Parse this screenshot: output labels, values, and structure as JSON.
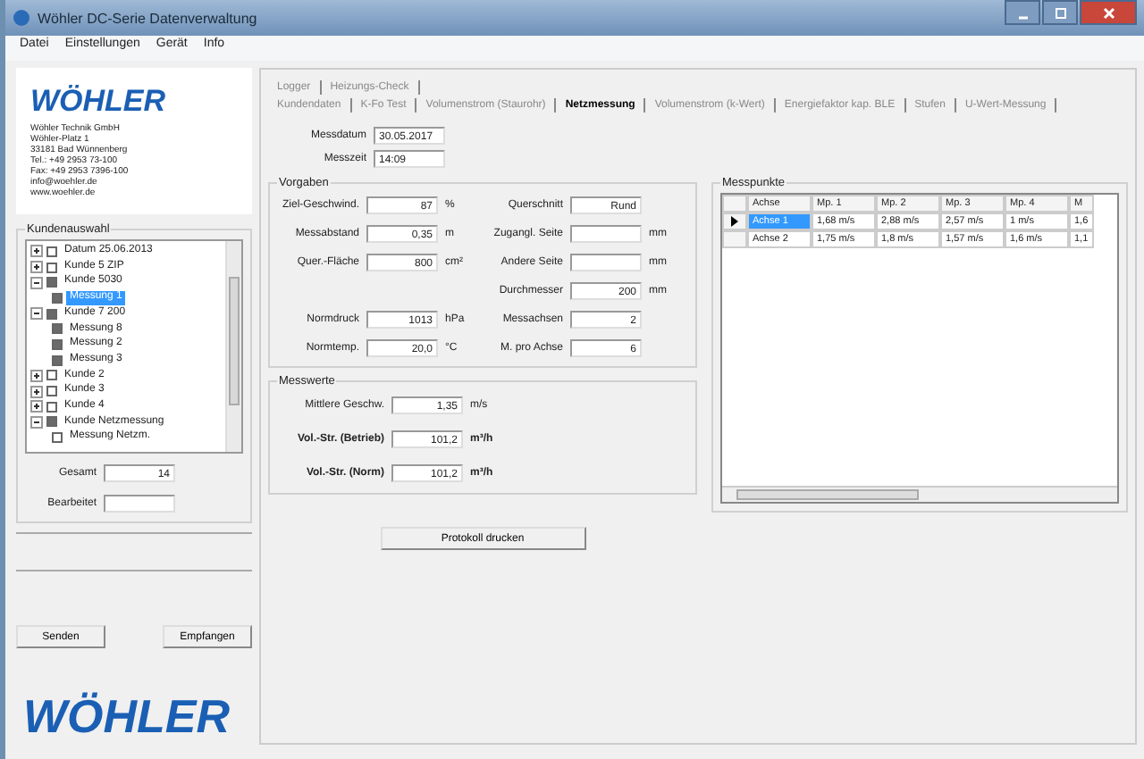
{
  "window": {
    "title": "Wöhler DC-Serie Datenverwaltung"
  },
  "menu": [
    "Datei",
    "Einstellungen",
    "Gerät",
    "Info"
  ],
  "company": {
    "logo": "WÖHLER",
    "lines": [
      "Wöhler Technik GmbH",
      "Wöhler-Platz 1",
      "33181 Bad Wünnenberg",
      "Tel.: +49 2953 73-100",
      "Fax: +49 2953 7396-100",
      "info@woehler.de",
      "www.woehler.de"
    ]
  },
  "customer_selection": {
    "title": "Kundenauswahl",
    "tree": [
      {
        "label": "Datum 25.06.2013",
        "checked": false,
        "expanded": false,
        "selected": false
      },
      {
        "label": "Kunde 5 ZIP",
        "checked": false,
        "expanded": false,
        "selected": false
      },
      {
        "label": "Kunde 5030",
        "checked": true,
        "expanded": true,
        "selected": false,
        "children": [
          {
            "label": "Messung 1",
            "checked": true,
            "selected": true
          }
        ]
      },
      {
        "label": "Kunde 7 200",
        "checked": true,
        "expanded": true,
        "selected": false,
        "children": [
          {
            "label": "Messung 8",
            "checked": true,
            "selected": false
          },
          {
            "label": "Messung 2",
            "checked": true,
            "selected": false
          },
          {
            "label": "Messung 3",
            "checked": true,
            "selected": false
          }
        ]
      },
      {
        "label": "Kunde 2",
        "checked": false,
        "expanded": false,
        "selected": false
      },
      {
        "label": "Kunde 3",
        "checked": false,
        "expanded": false,
        "selected": false
      },
      {
        "label": "Kunde 4",
        "checked": false,
        "expanded": false,
        "selected": false
      },
      {
        "label": "Kunde Netzmessung",
        "checked": true,
        "expanded": true,
        "selected": false,
        "children": [
          {
            "label": "Messung Netzm.",
            "checked": false,
            "selected": false
          }
        ]
      }
    ],
    "total_label": "Gesamt",
    "total": "14",
    "edited_label": "Bearbeitet"
  },
  "buttons": [
    "Senden",
    "Empfangen"
  ],
  "footer_logo": "WÖHLER",
  "tabs_row_1": [
    {
      "label": "Logger",
      "selected": false
    },
    {
      "label": "Heizungs-Check",
      "selected": false
    }
  ],
  "tabs_row_2": [
    {
      "label": "Kundendaten",
      "selected": false
    },
    {
      "label": "K-Fo Test",
      "selected": false
    },
    {
      "label": "Volumenstrom (Staurohr)",
      "selected": false
    },
    {
      "label": "Netzmessung",
      "selected": true
    },
    {
      "label": "Volumenstrom (k-Wert)",
      "selected": false
    },
    {
      "label": "Energiefaktor kap. BLE",
      "selected": false
    },
    {
      "label": "Stufen",
      "selected": false
    },
    {
      "label": "U-Wert-Messung",
      "selected": false
    }
  ],
  "measure_date": {
    "label": "Messdatum",
    "value": "30.05.2017"
  },
  "measure_time": {
    "label": "Messzeit",
    "value": "14:09"
  },
  "presets": {
    "title": "Vorgaben",
    "left": [
      {
        "label": "Ziel-Geschwind.",
        "value": "87",
        "unit": "%"
      },
      {
        "label": "Messabstand",
        "value": "0,35",
        "unit": "m"
      },
      {
        "label": "Quer.-Fläche",
        "value": "800",
        "unit": "cm²"
      },
      {
        "label": "Normdruck",
        "value": "1013",
        "unit": "hPa"
      },
      {
        "label": "Normtemp.",
        "value": "20,0",
        "unit": "°C"
      }
    ],
    "right": [
      {
        "label": "Querschnitt",
        "value": "Rund"
      },
      {
        "label": "Zugangl. Seite",
        "unit": "mm"
      },
      {
        "label": "Andere Seite",
        "unit": "mm"
      },
      {
        "label": "Durchmesser",
        "value": "200",
        "unit": "mm"
      },
      {
        "label": "Messachsen",
        "value": "2"
      },
      {
        "label": "M. pro Achse",
        "value": "6"
      }
    ]
  },
  "results": {
    "title": "Messwerte",
    "rows": [
      {
        "label": "Mittlere Geschw.",
        "value": "1,35",
        "unit": "m/s",
        "bold": false
      },
      {
        "label": "Vol.-Str. (Betrieb)",
        "value": "101,2",
        "unit": "m³/h",
        "bold": true
      },
      {
        "label": "Vol.-Str. (Norm)",
        "value": "101,2",
        "unit": "m³/h",
        "bold": true
      }
    ]
  },
  "print_button": "Protokoll drucken",
  "measuring_points": {
    "title": "Messpunkte",
    "columns": [
      "Achse",
      "Mp. 1",
      "Mp. 2",
      "Mp. 3",
      "Mp. 4",
      "M"
    ],
    "rows": [
      {
        "current": true,
        "cells": [
          {
            "text": "Achse 1",
            "selected": true
          },
          {
            "text": "1,68 m/s",
            "selected": false
          },
          {
            "text": "2,88 m/s",
            "selected": false
          },
          {
            "text": "2,57 m/s",
            "selected": false
          },
          {
            "text": "1 m/s",
            "selected": false
          },
          {
            "text": "1,6",
            "selected": false
          }
        ]
      },
      {
        "current": false,
        "cells": [
          {
            "text": "Achse 2",
            "selected": false
          },
          {
            "text": "1,75 m/s",
            "selected": false
          },
          {
            "text": "1,8 m/s",
            "selected": false
          },
          {
            "text": "1,57 m/s",
            "selected": false
          },
          {
            "text": "1,6 m/s",
            "selected": false
          },
          {
            "text": "1,1",
            "selected": false
          }
        ]
      }
    ]
  }
}
